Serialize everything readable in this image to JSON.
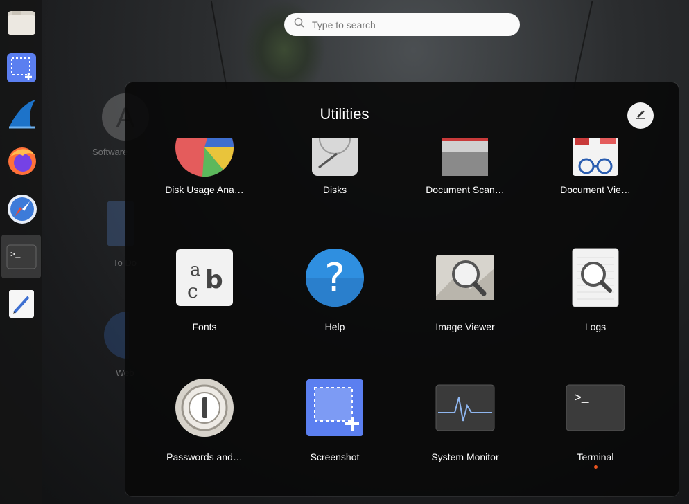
{
  "search": {
    "placeholder": "Type to search"
  },
  "dock": {
    "items": [
      {
        "name": "files-icon"
      },
      {
        "name": "screenshot-icon"
      },
      {
        "name": "wireshark-icon"
      },
      {
        "name": "firefox-icon"
      },
      {
        "name": "web-browser-icon"
      },
      {
        "name": "terminal-icon"
      },
      {
        "name": "text-editor-icon"
      }
    ]
  },
  "background": {
    "labels": [
      "Software",
      "To Do",
      "Web",
      "Wireshark"
    ]
  },
  "folder": {
    "title": "Utilities",
    "apps_row1": [
      {
        "label": "Disk Usage Ana…"
      },
      {
        "label": "Disks"
      },
      {
        "label": "Document Scan…"
      },
      {
        "label": "Document Vie…"
      }
    ],
    "apps_row2": [
      {
        "label": "Fonts"
      },
      {
        "label": "Help"
      },
      {
        "label": "Image Viewer"
      },
      {
        "label": "Logs"
      }
    ],
    "apps_row3": [
      {
        "label": "Passwords and…"
      },
      {
        "label": "Screenshot"
      },
      {
        "label": "System Monitor"
      },
      {
        "label": "Terminal"
      }
    ]
  },
  "colors": {
    "accent": "#e95420",
    "help_blue": "#2f8fe0",
    "screenshot_blue": "#5b7ff0"
  }
}
